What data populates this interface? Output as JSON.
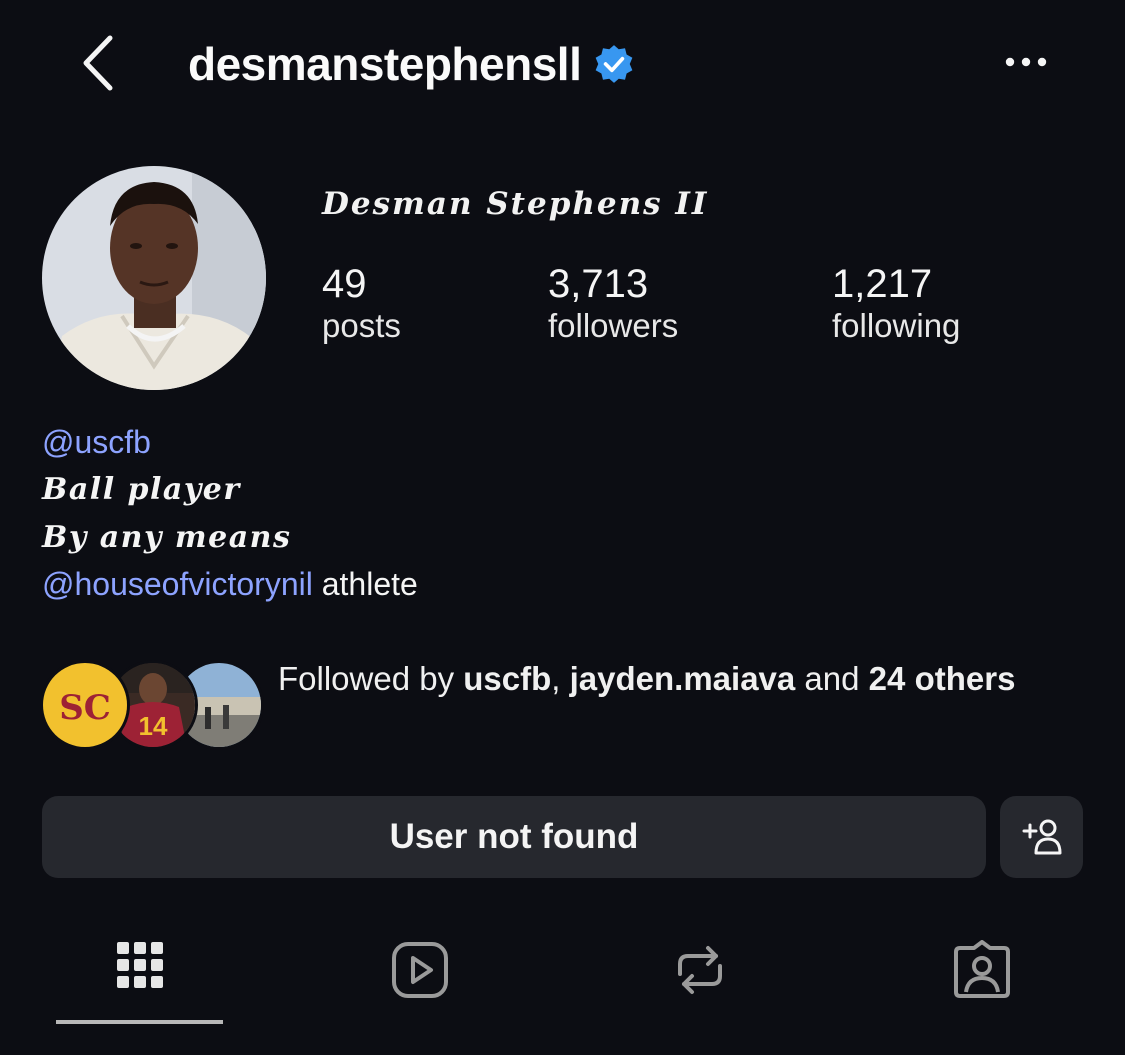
{
  "header": {
    "username": "desmanstephensll",
    "verified": true,
    "back_icon": "chevron-left-icon",
    "more_icon": "more-horizontal-icon"
  },
  "profile": {
    "display_name": "Desman Stephens II",
    "stats": [
      {
        "value": "49",
        "label": "posts"
      },
      {
        "value": "3,713",
        "label": "followers"
      },
      {
        "value": "1,217",
        "label": "following"
      }
    ]
  },
  "bio": {
    "line1": "@uscfb",
    "line2": "Ball player",
    "line3": "By any means",
    "line4_link": "@houseofvictorynil",
    "line4_text": " athlete"
  },
  "followed_by": {
    "prefix": "Followed by ",
    "user1": "uscfb",
    "sep": ", ",
    "user2": "jayden.maiava",
    "and": " and ",
    "count": "24",
    "others": "others",
    "mini_avatar1_text": "SC",
    "mini_avatar2_text": "14"
  },
  "actions": {
    "primary_label": "User not found",
    "secondary_icon": "add-person-icon"
  },
  "tabs": [
    {
      "icon": "grid-icon",
      "active": true
    },
    {
      "icon": "reels-icon",
      "active": false
    },
    {
      "icon": "reposts-icon",
      "active": false
    },
    {
      "icon": "tagged-icon",
      "active": false
    }
  ],
  "colors": {
    "background": "#0c0d13",
    "link": "#8da3ff",
    "verified_badge": "#3897f0",
    "button": "#26282e",
    "usc_gold": "#f2c12e",
    "usc_cardinal": "#9d2235"
  }
}
